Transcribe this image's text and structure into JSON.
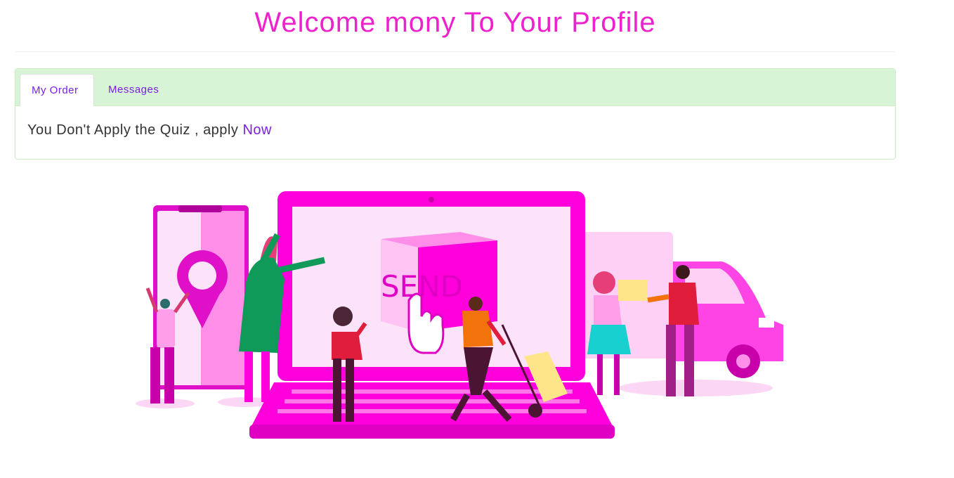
{
  "header": {
    "title": "Welcome mony To Your Profile"
  },
  "tabs": [
    {
      "label": "My Order",
      "active": true
    },
    {
      "label": "Messages",
      "active": false
    }
  ],
  "content": {
    "message": "You Don't Apply the Quiz , apply ",
    "link_label": "Now"
  },
  "illustration": {
    "box_text": "SEND"
  },
  "colors": {
    "accent": "#ee22cc",
    "link": "#7a1fdc",
    "tabbar_bg": "#d7f4d6",
    "magenta": "#ff00dd"
  }
}
